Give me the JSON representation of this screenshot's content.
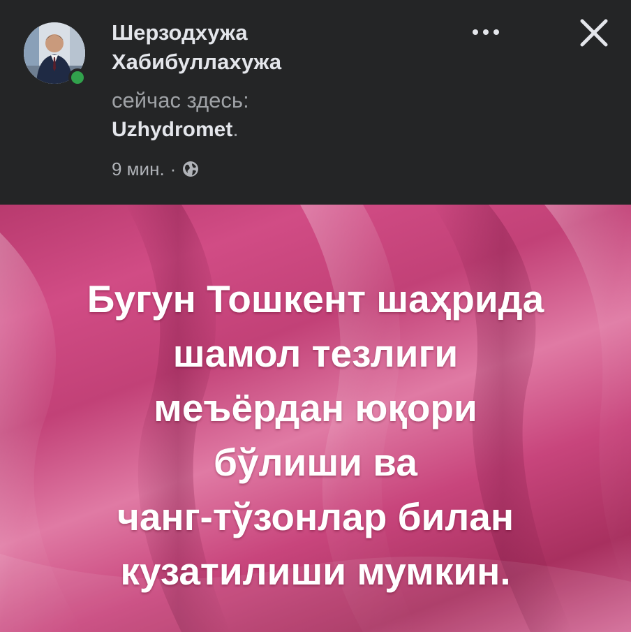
{
  "header": {
    "author_name_line1": "Шерзодхужа",
    "author_name_line2": "Хабибуллахужа",
    "status_text": "сейчас здесь:",
    "page_name": "Uzhydromet",
    "page_name_suffix": ".",
    "timestamp": "9 мин.",
    "separator": "·",
    "privacy_icon": "globe-icon",
    "more_icon": "more-dots-icon",
    "close_icon": "close-icon",
    "online_status_color": "#31a24c"
  },
  "post": {
    "lines": [
      "Бугун Тошкент шаҳрида",
      "шамол тезлиги",
      "меъёрдан юқори",
      "бўлиши ва",
      "чанг-тўзонлар билан",
      "кузатилиши мумкин."
    ],
    "background_color": "#c8457c",
    "text_color": "#ffffff"
  }
}
